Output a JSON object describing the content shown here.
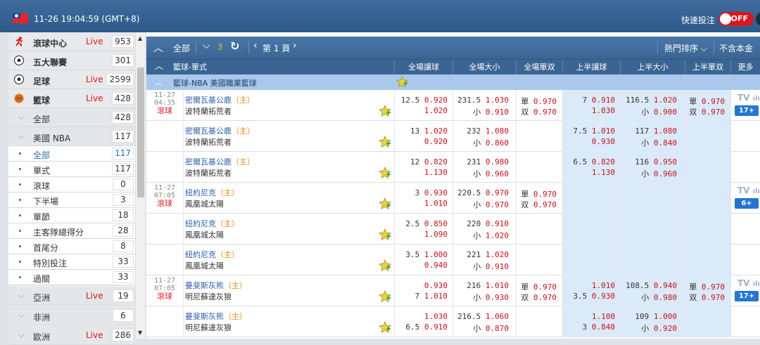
{
  "header": {
    "clock": "11-26 19:04:59 (GMT+8)",
    "quick_bet": "快速投注",
    "toggle": "OFF"
  },
  "sidebar": {
    "sports": [
      {
        "label": "滾球中心",
        "live": "Live",
        "count": "953",
        "icon": "running-icon"
      },
      {
        "label": "五大聯賽",
        "live": "",
        "count": "301",
        "icon": "soccer-ball-icon"
      },
      {
        "label": "足球",
        "live": "Live",
        "count": "2599",
        "icon": "soccer-ball-icon"
      },
      {
        "label": "籃球",
        "live": "Live",
        "count": "428",
        "icon": "basketball-icon"
      }
    ],
    "all": {
      "label": "全部",
      "count": "428"
    },
    "nba": {
      "label": "美國 NBA",
      "count": "117"
    },
    "nba_items": [
      {
        "label": "全部",
        "count": "117"
      },
      {
        "label": "單式",
        "count": "117"
      },
      {
        "label": "滾球",
        "count": "0"
      },
      {
        "label": "下半場",
        "count": "3"
      },
      {
        "label": "單節",
        "count": "18"
      },
      {
        "label": "主客隊總得分",
        "count": "28"
      },
      {
        "label": "首尾分",
        "count": "8"
      },
      {
        "label": "特別投注",
        "count": "33"
      },
      {
        "label": "過關",
        "count": "33"
      }
    ],
    "regions": [
      {
        "label": "亞洲",
        "live": "Live",
        "count": "19"
      },
      {
        "label": "非洲",
        "live": "",
        "count": "6"
      },
      {
        "label": "歐洲",
        "live": "Live",
        "count": "286"
      }
    ]
  },
  "toolbar": {
    "all": "全部",
    "count": "3",
    "page": "第 1 頁",
    "sort": "熱門排序",
    "principal": "不含本金"
  },
  "columns": {
    "title": "籃球-單式",
    "full_handicap": "全場讓球",
    "full_total": "全場大小",
    "full_oe": "全場單双",
    "half_handicap": "上半讓球",
    "half_total": "上半大小",
    "half_oe": "上半單双",
    "more": "更多"
  },
  "league": "籃球-NBA 美國職業籃球",
  "home_mark": "（主）",
  "rows": [
    {
      "date": "11-27",
      "time": "04:35",
      "live": "滾球",
      "home": "密爾瓦基公鹿",
      "away": "波特蘭拓荒者",
      "fh_h_line": "12.5",
      "fh_h_odd": "0.920",
      "fh_a_line": "",
      "fh_a_odd": "1.020",
      "ft_o_line": "231.5",
      "ft_o_odd": "1.030",
      "ft_u_line": "小",
      "ft_u_odd": "0.910",
      "oe_o_lbl": "單",
      "oe_o_odd": "0.970",
      "oe_e_lbl": "双",
      "oe_e_odd": "0.970",
      "hh_h_line": "7",
      "hh_h_odd": "0.910",
      "hh_a_line": "",
      "hh_a_odd": "1.030",
      "ht_o_line": "116.5",
      "ht_o_odd": "1.020",
      "ht_u_line": "小",
      "ht_u_odd": "0.900",
      "hoe_o_lbl": "單",
      "hoe_o_odd": "0.970",
      "hoe_e_lbl": "双",
      "hoe_e_odd": "0.970",
      "tv": "TV",
      "more": "17+"
    },
    {
      "date": "",
      "time": "",
      "live": "",
      "home": "密爾瓦基公鹿",
      "away": "波特蘭拓荒者",
      "fh_h_line": "13",
      "fh_h_odd": "1.020",
      "fh_a_line": "",
      "fh_a_odd": "0.920",
      "ft_o_line": "232",
      "ft_o_odd": "1.080",
      "ft_u_line": "小",
      "ft_u_odd": "0.860",
      "oe_o_lbl": "",
      "oe_o_odd": "",
      "oe_e_lbl": "",
      "oe_e_odd": "",
      "hh_h_line": "7.5",
      "hh_h_odd": "1.010",
      "hh_a_line": "",
      "hh_a_odd": "0.930",
      "ht_o_line": "117",
      "ht_o_odd": "1.080",
      "ht_u_line": "小",
      "ht_u_odd": "0.840",
      "hoe_o_lbl": "",
      "hoe_o_odd": "",
      "hoe_e_lbl": "",
      "hoe_e_odd": "",
      "tv": "",
      "more": ""
    },
    {
      "date": "",
      "time": "",
      "live": "",
      "home": "密爾瓦基公鹿",
      "away": "波特蘭拓荒者",
      "fh_h_line": "12",
      "fh_h_odd": "0.820",
      "fh_a_line": "",
      "fh_a_odd": "1.130",
      "ft_o_line": "231",
      "ft_o_odd": "0.980",
      "ft_u_line": "小",
      "ft_u_odd": "0.960",
      "oe_o_lbl": "",
      "oe_o_odd": "",
      "oe_e_lbl": "",
      "oe_e_odd": "",
      "hh_h_line": "6.5",
      "hh_h_odd": "0.820",
      "hh_a_line": "",
      "hh_a_odd": "1.130",
      "ht_o_line": "116",
      "ht_o_odd": "0.950",
      "ht_u_line": "小",
      "ht_u_odd": "0.960",
      "hoe_o_lbl": "",
      "hoe_o_odd": "",
      "hoe_e_lbl": "",
      "hoe_e_odd": "",
      "tv": "",
      "more": ""
    },
    {
      "date": "11-27",
      "time": "07:05",
      "live": "滾球",
      "home": "紐約尼克",
      "away": "鳳凰城太陽",
      "fh_h_line": "3",
      "fh_h_odd": "0.930",
      "fh_a_line": "",
      "fh_a_odd": "1.010",
      "ft_o_line": "220.5",
      "ft_o_odd": "0.970",
      "ft_u_line": "小",
      "ft_u_odd": "0.970",
      "oe_o_lbl": "單",
      "oe_o_odd": "0.970",
      "oe_e_lbl": "双",
      "oe_e_odd": "0.970",
      "hh_h_line": "",
      "hh_h_odd": "",
      "hh_a_line": "",
      "hh_a_odd": "",
      "ht_o_line": "",
      "ht_o_odd": "",
      "ht_u_line": "",
      "ht_u_odd": "",
      "hoe_o_lbl": "",
      "hoe_o_odd": "",
      "hoe_e_lbl": "",
      "hoe_e_odd": "",
      "tv": "TV",
      "more": "6+"
    },
    {
      "date": "",
      "time": "",
      "live": "",
      "home": "紐約尼克",
      "away": "鳳凰城太陽",
      "fh_h_line": "2.5",
      "fh_h_odd": "0.850",
      "fh_a_line": "",
      "fh_a_odd": "1.090",
      "ft_o_line": "220",
      "ft_o_odd": "0.910",
      "ft_u_line": "小",
      "ft_u_odd": "1.020",
      "oe_o_lbl": "",
      "oe_o_odd": "",
      "oe_e_lbl": "",
      "oe_e_odd": "",
      "hh_h_line": "",
      "hh_h_odd": "",
      "hh_a_line": "",
      "hh_a_odd": "",
      "ht_o_line": "",
      "ht_o_odd": "",
      "ht_u_line": "",
      "ht_u_odd": "",
      "hoe_o_lbl": "",
      "hoe_o_odd": "",
      "hoe_e_lbl": "",
      "hoe_e_odd": "",
      "tv": "",
      "more": ""
    },
    {
      "date": "",
      "time": "",
      "live": "",
      "home": "紐約尼克",
      "away": "鳳凰城太陽",
      "fh_h_line": "3.5",
      "fh_h_odd": "1.000",
      "fh_a_line": "",
      "fh_a_odd": "0.940",
      "ft_o_line": "221",
      "ft_o_odd": "1.020",
      "ft_u_line": "小",
      "ft_u_odd": "0.910",
      "oe_o_lbl": "",
      "oe_o_odd": "",
      "oe_e_lbl": "",
      "oe_e_odd": "",
      "hh_h_line": "",
      "hh_h_odd": "",
      "hh_a_line": "",
      "hh_a_odd": "",
      "ht_o_line": "",
      "ht_o_odd": "",
      "ht_u_line": "",
      "ht_u_odd": "",
      "hoe_o_lbl": "",
      "hoe_o_odd": "",
      "hoe_e_lbl": "",
      "hoe_e_odd": "",
      "tv": "",
      "more": ""
    },
    {
      "date": "11-27",
      "time": "07:05",
      "live": "滾球",
      "home": "曼斐斯灰熊",
      "away": "明尼蘇達灰狼",
      "fh_h_line": "",
      "fh_h_odd": "0.930",
      "fh_a_line": "7",
      "fh_a_odd": "1.010",
      "ft_o_line": "216",
      "ft_o_odd": "1.010",
      "ft_u_line": "小",
      "ft_u_odd": "0.930",
      "oe_o_lbl": "單",
      "oe_o_odd": "0.970",
      "oe_e_lbl": "双",
      "oe_e_odd": "0.970",
      "hh_h_line": "",
      "hh_h_odd": "1.010",
      "hh_a_line": "3.5",
      "hh_a_odd": "0.930",
      "ht_o_line": "108.5",
      "ht_o_odd": "0.940",
      "ht_u_line": "小",
      "ht_u_odd": "0.980",
      "hoe_o_lbl": "單",
      "hoe_o_odd": "0.970",
      "hoe_e_lbl": "双",
      "hoe_e_odd": "0.970",
      "tv": "TV",
      "more": "17+"
    },
    {
      "date": "",
      "time": "",
      "live": "",
      "home": "曼斐斯灰熊",
      "away": "明尼蘇達灰狼",
      "fh_h_line": "",
      "fh_h_odd": "1.030",
      "fh_a_line": "6.5",
      "fh_a_odd": "0.910",
      "ft_o_line": "216.5",
      "ft_o_odd": "1.060",
      "ft_u_line": "小",
      "ft_u_odd": "0.870",
      "oe_o_lbl": "",
      "oe_o_odd": "",
      "oe_e_lbl": "",
      "oe_e_odd": "",
      "hh_h_line": "",
      "hh_h_odd": "1.100",
      "hh_a_line": "3",
      "hh_a_odd": "0.840",
      "ht_o_line": "109",
      "ht_o_odd": "1.000",
      "ht_u_line": "小",
      "ht_u_odd": "0.920",
      "hoe_o_lbl": "",
      "hoe_o_odd": "",
      "hoe_e_lbl": "",
      "hoe_e_odd": "",
      "tv": "",
      "more": ""
    }
  ]
}
